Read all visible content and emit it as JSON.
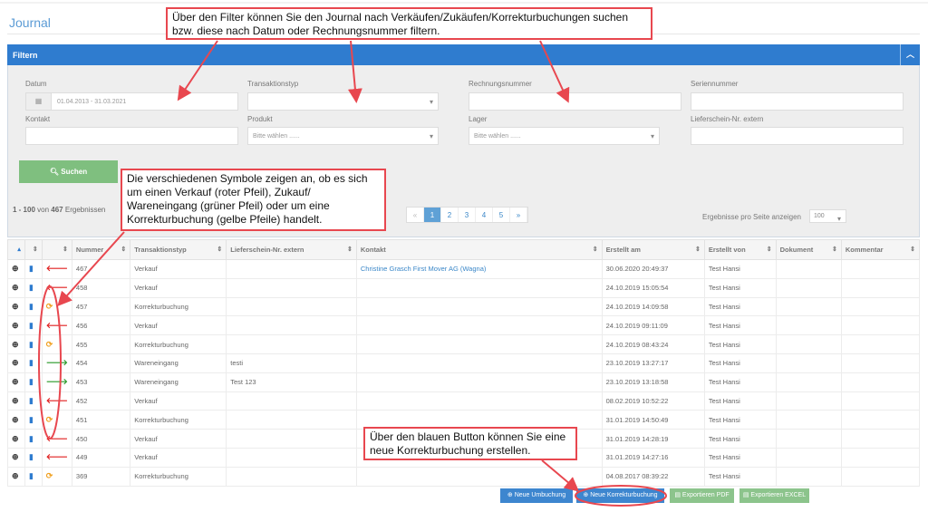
{
  "page": {
    "title": "Journal"
  },
  "filter": {
    "header": "Filtern",
    "collapse_icon": "chevron-up-icon",
    "fields": [
      {
        "label": "Datum",
        "value": "01.04.2013 - 31.03.2021"
      },
      {
        "label": "Transaktionstyp",
        "value": ""
      },
      {
        "label": "Rechnungsnummer",
        "value": ""
      },
      {
        "label": "Seriennummer",
        "value": ""
      },
      {
        "label": "Kontakt",
        "value": ""
      },
      {
        "label": "Produkt",
        "placeholder": "Bitte wählen ......"
      },
      {
        "label": "Lager",
        "placeholder": "Bitte wählen ......"
      },
      {
        "label": "Lieferschein-Nr. extern",
        "value": ""
      }
    ],
    "search_button": "Suchen"
  },
  "results": {
    "range": "1 - 100",
    "von": "von",
    "total": "467",
    "suffix": "Ergebnissen"
  },
  "pagination": {
    "prev": "«",
    "pages": [
      "1",
      "2",
      "3",
      "4",
      "5"
    ],
    "active": "1",
    "next": "»"
  },
  "per_page": {
    "label": "Ergebnisse pro Seite anzeigen",
    "value": "100"
  },
  "table": {
    "columns": [
      "",
      "",
      "",
      "Nummer",
      "Transaktionstyp",
      "Lieferschein-Nr. extern",
      "Kontakt",
      "Erstellt am",
      "Erstellt von",
      "Dokument",
      "Kommentar"
    ],
    "rows": [
      {
        "type_icon": "red-arrow-left",
        "nummer": "467",
        "typ": "Verkauf",
        "lief": "",
        "kontakt": "Christine Grasch First Mover AG (Wagna)",
        "erstellt": "30.06.2020 20:49:37",
        "von": "Test Hansi"
      },
      {
        "type_icon": "red-arrow-left",
        "nummer": "458",
        "typ": "Verkauf",
        "lief": "",
        "kontakt": "",
        "erstellt": "24.10.2019 15:05:54",
        "von": "Test Hansi"
      },
      {
        "type_icon": "yellow-refresh",
        "nummer": "457",
        "typ": "Korrekturbuchung",
        "lief": "",
        "kontakt": "",
        "erstellt": "24.10.2019 14:09:58",
        "von": "Test Hansi"
      },
      {
        "type_icon": "red-arrow-left",
        "nummer": "456",
        "typ": "Verkauf",
        "lief": "",
        "kontakt": "",
        "erstellt": "24.10.2019 09:11:09",
        "von": "Test Hansi"
      },
      {
        "type_icon": "yellow-refresh",
        "nummer": "455",
        "typ": "Korrekturbuchung",
        "lief": "",
        "kontakt": "",
        "erstellt": "24.10.2019 08:43:24",
        "von": "Test Hansi"
      },
      {
        "type_icon": "green-arrow-right",
        "nummer": "454",
        "typ": "Wareneingang",
        "lief": "testi",
        "kontakt": "",
        "erstellt": "23.10.2019 13:27:17",
        "von": "Test Hansi"
      },
      {
        "type_icon": "green-arrow-right",
        "nummer": "453",
        "typ": "Wareneingang",
        "lief": "Test 123",
        "kontakt": "",
        "erstellt": "23.10.2019 13:18:58",
        "von": "Test Hansi"
      },
      {
        "type_icon": "red-arrow-left",
        "nummer": "452",
        "typ": "Verkauf",
        "lief": "",
        "kontakt": "",
        "erstellt": "08.02.2019 10:52:22",
        "von": "Test Hansi"
      },
      {
        "type_icon": "yellow-refresh",
        "nummer": "451",
        "typ": "Korrekturbuchung",
        "lief": "",
        "kontakt": "",
        "erstellt": "31.01.2019 14:50:49",
        "von": "Test Hansi"
      },
      {
        "type_icon": "red-arrow-left",
        "nummer": "450",
        "typ": "Verkauf",
        "lief": "",
        "kontakt": "",
        "erstellt": "31.01.2019 14:28:19",
        "von": "Test Hansi"
      },
      {
        "type_icon": "red-arrow-left",
        "nummer": "449",
        "typ": "Verkauf",
        "lief": "",
        "kontakt": "",
        "erstellt": "31.01.2019 14:27:16",
        "von": "Test Hansi"
      },
      {
        "type_icon": "yellow-refresh",
        "nummer": "369",
        "typ": "Korrekturbuchung",
        "lief": "",
        "kontakt": "",
        "erstellt": "04.08.2017 08:39:22",
        "von": "Test Hansi"
      }
    ]
  },
  "actions": {
    "neue_umbuchung": "Neue Umbuchung",
    "neue_korrektur": "Neue Korrekturbuchung",
    "export_pdf": "Exportieren PDF",
    "export_excel": "Exportieren EXCEL"
  },
  "annotations": {
    "filter_note": "Über den Filter können Sie den Journal nach Verkäufen/Zukäufen/Korrekturbuchungen suchen bzw. diese nach Datum oder Rechnungsnummer filtern.",
    "symbol_note": "Die verschiedenen Symbole zeigen an, ob es sich um einen Verkauf (roter Pfeil), Zukauf/ Wareneingang (grüner Pfeil) oder um eine Korrekturbuchung (gelbe Pfeile) handelt.",
    "button_note": "Über den blauen Button können Sie eine neue Korrekturbuchung erstellen."
  },
  "colors": {
    "primary": "#2f7ccf",
    "success": "#7fbf7f",
    "annotation": "#e8474f",
    "sale": "#e02020",
    "purchase": "#2a9a2a",
    "correction": "#f0a020"
  }
}
